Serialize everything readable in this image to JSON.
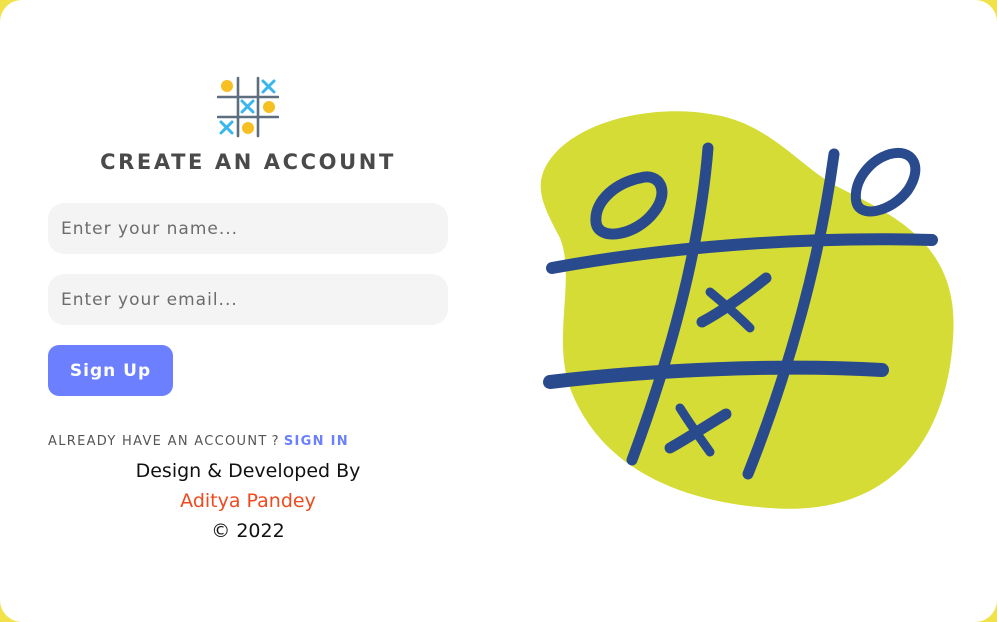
{
  "colors": {
    "accent": "#6b7fff",
    "author": "#ee4a1e",
    "blob": "#d4dc35",
    "ink": "#2a4a8e",
    "frame": "#f2e24a"
  },
  "logo": {
    "icon": "tic-tac-toe-logo-icon"
  },
  "form": {
    "title": "CREATE AN ACCOUNT",
    "name_placeholder": "Enter your name...",
    "email_placeholder": "Enter your email...",
    "signup_label": "Sign Up"
  },
  "account": {
    "prompt": "ALREADY HAVE AN ACCOUNT",
    "qmark": "?",
    "signin_label": "SIGN IN"
  },
  "credits": {
    "line1": "Design & Developed By",
    "author": "Aditya Pandey",
    "copyright": "© 2022"
  },
  "illustration": {
    "icon": "tic-tac-toe-board-illustration"
  }
}
